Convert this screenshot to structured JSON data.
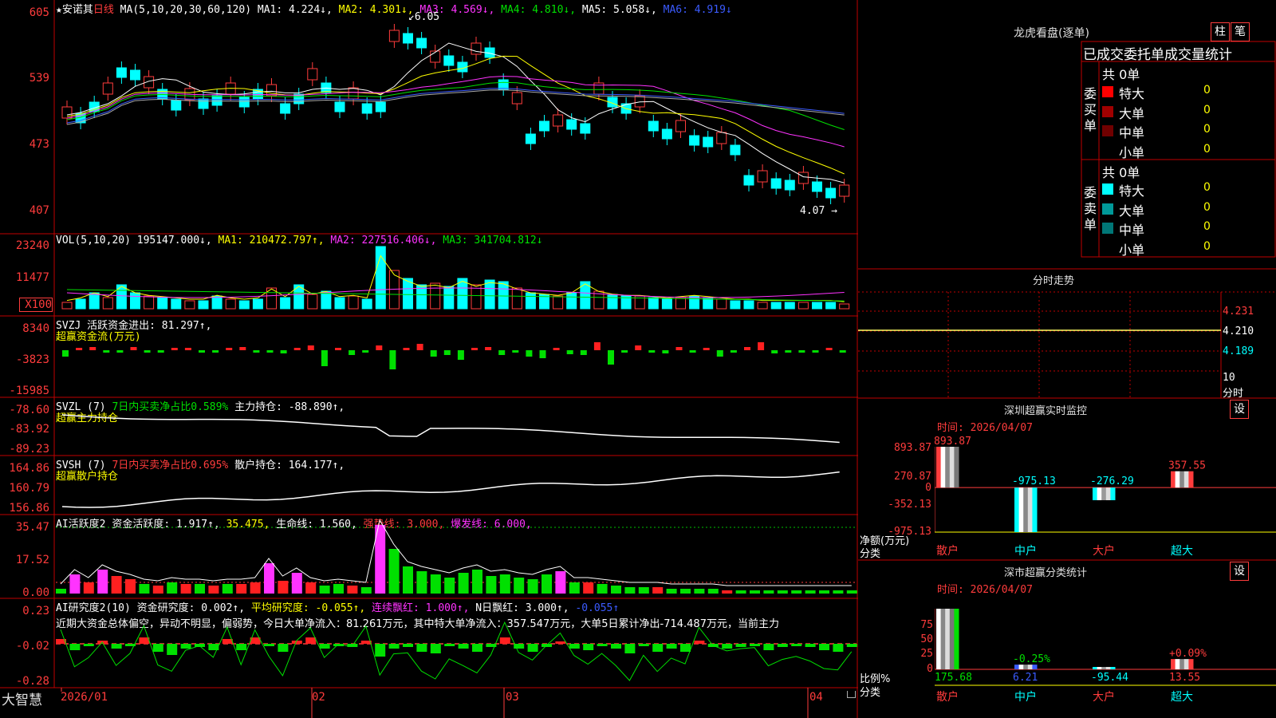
{
  "main_chart": {
    "y_ticks": [
      "605",
      "539",
      "473",
      "407"
    ],
    "legend": {
      "stock": "★安诺其",
      "period": "日线",
      "ma_params": "MA(5,10,20,30,60,120)",
      "ma1": "MA1: 4.224↓,",
      "ma2": "MA2: 4.301↓,",
      "ma3": "MA3: 4.569↓,",
      "ma4": "MA4: 4.810↓,",
      "ma5": "MA5: 5.058↓,",
      "ma6": "MA6: 4.919↓"
    },
    "high_label": "6.05",
    "low_label": "4.07"
  },
  "vol_panel": {
    "y_ticks": [
      "23240",
      "11477",
      "X100"
    ],
    "legend": {
      "name": "VOL(5,10,20)",
      "value": "195147.000↓,",
      "ma1": "MA1: 210472.797↑,",
      "ma2": "MA2: 227516.406↓,",
      "ma3": "MA3: 341704.812↓"
    }
  },
  "svzj_panel": {
    "y_ticks": [
      "8340",
      "-3823",
      "-15985"
    ],
    "line1": "SVZJ  活跃资金进出: 81.297↑,",
    "line2": "超赢资金流(万元)"
  },
  "svzl_panel": {
    "y_ticks": [
      "-78.60",
      "-83.92",
      "-89.23"
    ],
    "prefix": "SVZL (7)",
    "ratio": "7日内买卖净占比0.589%",
    "value": "主力持仓: -88.890↑,",
    "line2": "超赢主力持仓"
  },
  "svsh_panel": {
    "y_ticks": [
      "164.86",
      "160.79",
      "156.86"
    ],
    "prefix": "SVSH (7)",
    "ratio": "7日内买卖净占比0.695%",
    "value": "散户持仓: 164.177↑,",
    "line2": "超赢散户持仓"
  },
  "ai2_panel": {
    "y_ticks": [
      "35.47",
      "17.52",
      "0.00"
    ],
    "prefix": "AI活跃度2",
    "v1": "资金活跃度: 1.917↑,",
    "v2": "35.475,",
    "v3": "生命线: 1.560,",
    "v4": "强势线: 3.000,",
    "v5": "爆发线: 6.000,"
  },
  "research_panel": {
    "y_ticks": [
      "0.23",
      "-0.02",
      "-0.28"
    ],
    "prefix": "AI研究度2(10)",
    "v1": "资金研究度: 0.002↑,",
    "v2": "平均研究度: -0.055↑,",
    "v3": "连续飘红: 1.000↑,",
    "v4": "N日飘红: 3.000↑,",
    "v5": "-0.055↑",
    "summary": "近期大资金总体偏空，异动不明显，偏弱势，今日大单净流入：81.261万元，其中特大单净流入：357.547万元，大单5日累计净出-714.487万元，当前主力"
  },
  "x_axis": {
    "brand": "大智慧",
    "labels": [
      "2026/01",
      "02",
      "03",
      "04"
    ]
  },
  "right_panel": {
    "dragon": {
      "title": "龙虎看盘(逐单)",
      "btn_bar": "柱",
      "btn_pen": "笔",
      "subtitle": "已成交委托单成交量统计",
      "buy_label": "委买单",
      "buy_total": "共 0单",
      "sell_label": "委卖单",
      "sell_total": "共 0单",
      "buy_rows": [
        {
          "name": "特大",
          "value": "0",
          "color": "#ff0000"
        },
        {
          "name": "大单",
          "value": "0",
          "color": "#a00000"
        },
        {
          "name": "中单",
          "value": "0",
          "color": "#700000"
        },
        {
          "name": "小单",
          "value": "0",
          "color": "#000000"
        }
      ],
      "sell_rows": [
        {
          "name": "特大",
          "value": "0",
          "color": "#00ffff"
        },
        {
          "name": "大单",
          "value": "0",
          "color": "#009999"
        },
        {
          "name": "中单",
          "value": "0",
          "color": "#007777"
        },
        {
          "name": "小单",
          "value": "0",
          "color": "#000000"
        }
      ]
    },
    "intraday": {
      "title": "分时走势",
      "prices": [
        "4.231",
        "4.210",
        "4.189"
      ],
      "vol_label": "10",
      "time_label": "分时"
    },
    "sz_monitor": {
      "title": "深圳超赢实时监控",
      "btn": "设",
      "time": "时间: 2026/04/07",
      "y_ticks": [
        "893.87",
        "270.87",
        "0",
        "-352.13",
        "-975.13"
      ],
      "y_label_1": "净额(万元)",
      "y_label_2": "分类",
      "categories": [
        "散户",
        "中户",
        "大户",
        "超大"
      ]
    },
    "sz_stats": {
      "title": "深市超赢分类统计",
      "btn": "设",
      "time": "时间: 2026/04/07",
      "y_ticks": [
        "75",
        "50",
        "25",
        "0"
      ],
      "y_label_1": "比例%",
      "y_label_2": "分类",
      "categories": [
        "散户",
        "中户",
        "大户",
        "超大"
      ]
    }
  },
  "chart_data": [
    {
      "type": "bar",
      "title": "深圳超赢实时监控",
      "ylabel": "净额(万元)",
      "xlabel": "分类",
      "categories": [
        "散户",
        "中户",
        "大户",
        "超大"
      ],
      "values": [
        893.87,
        -975.13,
        -276.29,
        357.55
      ],
      "data_labels": [
        "893.87",
        "-975.13",
        "-276.29",
        "357.55"
      ],
      "ylim": [
        -975.13,
        893.87
      ]
    },
    {
      "type": "bar",
      "title": "深市超赢分类统计",
      "ylabel": "比例%",
      "xlabel": "分类",
      "categories": [
        "散户",
        "中户",
        "大户",
        "超大"
      ],
      "values": [
        175.68,
        6.21,
        -95.44,
        13.55
      ],
      "data_labels": [
        "175.68",
        "6.21",
        "-95.44",
        "13.55"
      ],
      "extra_labels": [
        "",
        "-0.25%",
        "",
        "+0.09%"
      ],
      "ylim": [
        0,
        80
      ]
    }
  ]
}
